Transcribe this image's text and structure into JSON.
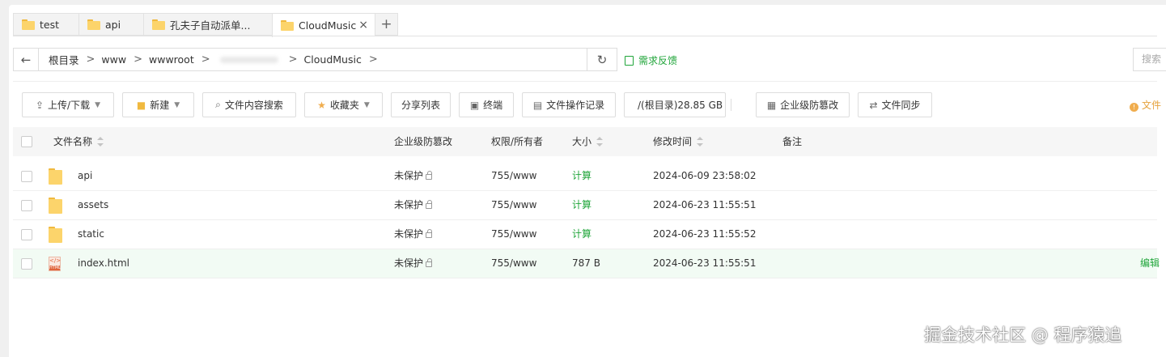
{
  "tabs": [
    {
      "label": "test",
      "active": false
    },
    {
      "label": "api",
      "active": false
    },
    {
      "label": "孔夫子自动派单...",
      "active": false
    },
    {
      "label": "CloudMusic",
      "active": true
    }
  ],
  "tab_close_glyph": "×",
  "tab_add_glyph": "+",
  "address": {
    "back_glyph": "←",
    "crumbs": [
      "根目录",
      "www",
      "wwwroot",
      "CloudMusic"
    ],
    "sep_glyph": ">",
    "refresh_glyph": "↻",
    "feedback_label": "需求反馈",
    "search_placeholder": "搜索"
  },
  "toolbar": {
    "upload": "上传/下载",
    "new": "新建",
    "content_search": "文件内容搜索",
    "favorites": "收藏夹",
    "share_list": "分享列表",
    "terminal": "终端",
    "op_log": "文件操作记录",
    "disk": "/(根目录)28.85 GB",
    "tamper": "企业级防篡改",
    "sync": "文件同步",
    "info_label": "文件"
  },
  "table": {
    "headers": {
      "name": "文件名称",
      "tamper": "企业级防篡改",
      "perm": "权限/所有者",
      "size": "大小",
      "mtime": "修改时间",
      "note": "备注"
    },
    "rows": [
      {
        "name": "api",
        "type": "folder",
        "tamper": "未保护",
        "perm": "755/www",
        "size": "计算",
        "mtime": "2024-06-09 23:58:02",
        "action": ""
      },
      {
        "name": "assets",
        "type": "folder",
        "tamper": "未保护",
        "perm": "755/www",
        "size": "计算",
        "mtime": "2024-06-23 11:55:51",
        "action": ""
      },
      {
        "name": "static",
        "type": "folder",
        "tamper": "未保护",
        "perm": "755/www",
        "size": "计算",
        "mtime": "2024-06-23 11:55:52",
        "action": ""
      },
      {
        "name": "index.html",
        "type": "html",
        "tamper": "未保护",
        "perm": "755/www",
        "size": "787 B",
        "mtime": "2024-06-23 11:55:51",
        "action": "编辑"
      }
    ]
  },
  "html_icon_text": "</>",
  "html_icon_tag": "HTML",
  "watermark": "掘金技术社区 @ 程序猿追",
  "colors": {
    "accent": "#20a53a",
    "folder": "#fcd46b",
    "warning": "#e6a23c"
  }
}
